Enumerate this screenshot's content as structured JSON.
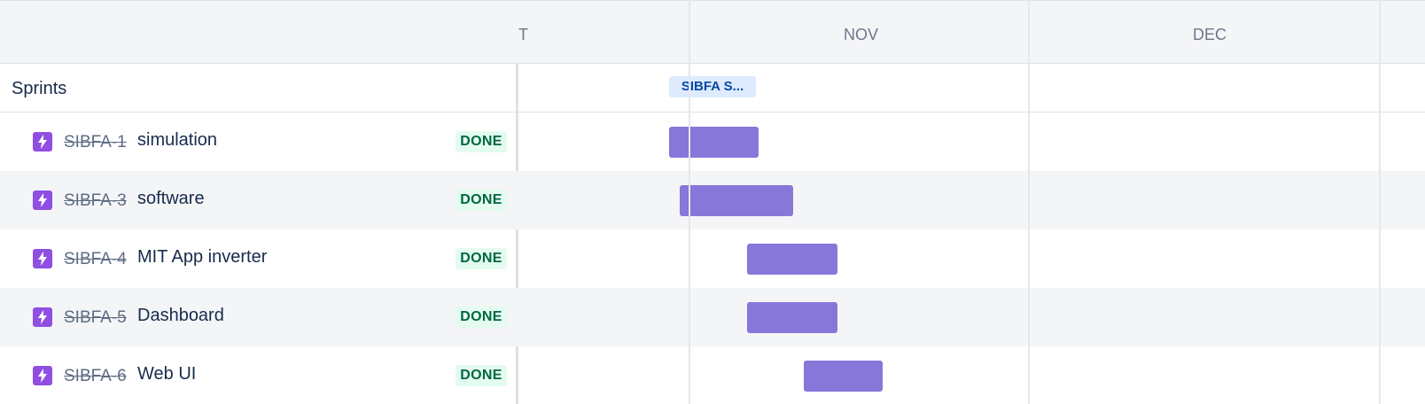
{
  "timeline": {
    "months": [
      "T",
      "NOV",
      "DEC"
    ],
    "sprint_chip": "SIBFA S..."
  },
  "sprints": {
    "label": "Sprints"
  },
  "issues": [
    {
      "key": "SIBFA-1",
      "title": "simulation",
      "status": "DONE"
    },
    {
      "key": "SIBFA-3",
      "title": "software",
      "status": "DONE"
    },
    {
      "key": "SIBFA-4",
      "title": "MIT App inverter",
      "status": "DONE"
    },
    {
      "key": "SIBFA-5",
      "title": "Dashboard",
      "status": "DONE"
    },
    {
      "key": "SIBFA-6",
      "title": "Web UI",
      "status": "DONE"
    }
  ],
  "colors": {
    "issue_icon": "#904ee2",
    "bar": "#8777d9",
    "status_bg": "#e3fcef",
    "status_text": "#006644",
    "chip_bg": "#deebff",
    "chip_text": "#0747a6"
  },
  "icons": {
    "issue_type": "lightning-bolt-icon"
  }
}
